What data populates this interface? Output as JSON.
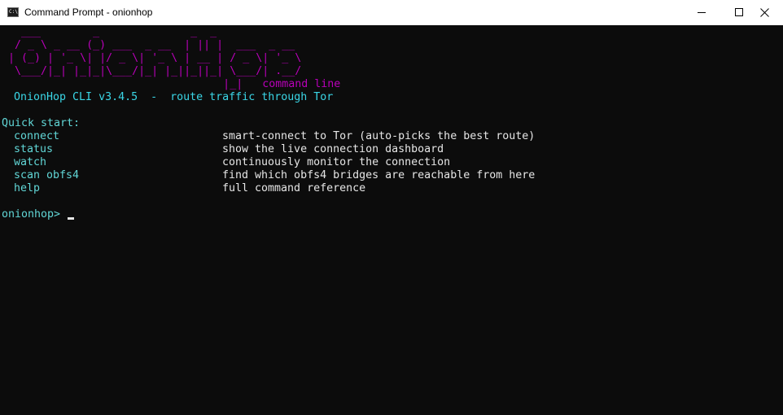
{
  "titlebar": {
    "icon_text": "C:\\",
    "title": "Command Prompt - onionhop"
  },
  "banner": {
    "ascii_lines": [
      "   ___        _              _  _",
      "  / _ \\ _ __ (_) ___  _ __  | || |  ___  _ __",
      " | (_) | '_ \\| |/ _ \\| '_ \\ | __ | / _ \\| '_ \\",
      "  \\___/|_| |_|_|\\___/|_| |_||_||_| \\___/| .__/",
      "                                  |_|   "
    ],
    "tagline": "command line",
    "version_line": "OnionHop CLI v3.4.5  -  route traffic through Tor"
  },
  "quick_start": {
    "heading": "Quick start:",
    "commands": [
      {
        "name": "connect",
        "description": "smart-connect to Tor (auto-picks the best route)"
      },
      {
        "name": "status",
        "description": "show the live connection dashboard"
      },
      {
        "name": "watch",
        "description": "continuously monitor the connection"
      },
      {
        "name": "scan obfs4",
        "description": "find which obfs4 bridges are reachable from here"
      },
      {
        "name": "help",
        "description": "full command reference"
      }
    ]
  },
  "prompt": {
    "text": "onionhop>"
  },
  "colors": {
    "background": "#0c0c0c",
    "banner": "#b900b9",
    "accent": "#61d6d6",
    "text": "#e6e6e6"
  }
}
